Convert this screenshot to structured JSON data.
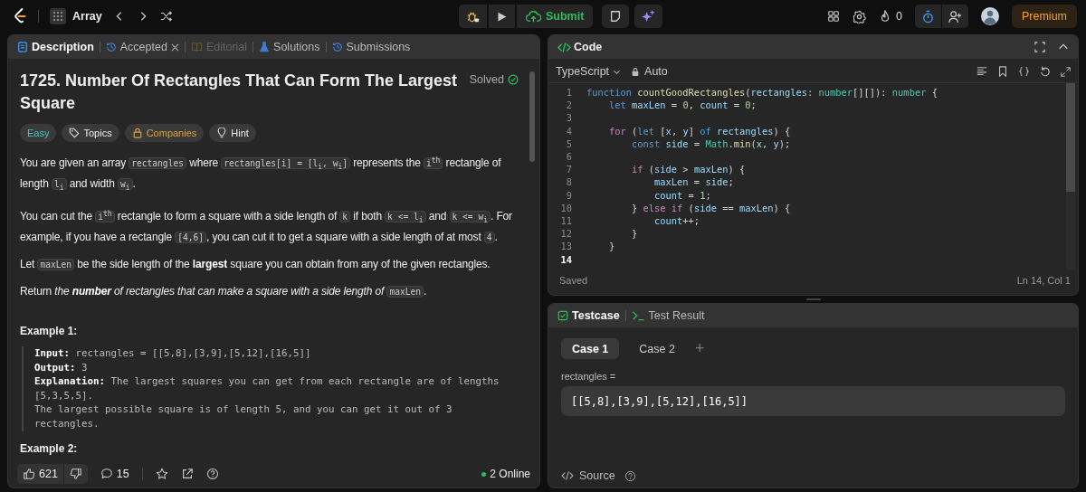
{
  "topbar": {
    "problem_list": "Array",
    "submit": "Submit",
    "streak": "0",
    "premium": "Premium"
  },
  "description_tabs": [
    {
      "label": "Description",
      "selected": true,
      "disabled": false,
      "closable": false,
      "kind": "description"
    },
    {
      "label": "Accepted",
      "selected": false,
      "disabled": false,
      "closable": true,
      "kind": "history"
    },
    {
      "label": "Editorial",
      "selected": false,
      "disabled": true,
      "closable": false,
      "kind": "editorial"
    },
    {
      "label": "Solutions",
      "selected": false,
      "disabled": false,
      "closable": false,
      "kind": "solutions"
    },
    {
      "label": "Submissions",
      "selected": false,
      "disabled": false,
      "closable": false,
      "kind": "history"
    }
  ],
  "problem": {
    "title": "1725. Number Of Rectangles That Can Form The Largest Square",
    "status": "Solved",
    "tags": [
      {
        "label": "Easy",
        "kind": "difficulty"
      },
      {
        "label": "Topics",
        "kind": "topics"
      },
      {
        "label": "Companies",
        "kind": "companies"
      },
      {
        "label": "Hint",
        "kind": "hint"
      }
    ],
    "paragraphs": [
      [
        {
          "kind": "text",
          "text": "You are given an array "
        },
        {
          "kind": "code",
          "text": "rectangles"
        },
        {
          "kind": "text",
          "text": " where "
        },
        {
          "kind": "code",
          "text": "rectangles[i] = [l$_{i}$, w$_{i}$]"
        },
        {
          "kind": "text",
          "text": " represents the "
        },
        {
          "kind": "code",
          "text": "i$^{th}$"
        },
        {
          "kind": "text",
          "text": " rectangle of length "
        },
        {
          "kind": "code",
          "text": "l$_{i}$"
        },
        {
          "kind": "text",
          "text": " and width "
        },
        {
          "kind": "code",
          "text": "w$_{i}$"
        },
        {
          "kind": "text",
          "text": "."
        }
      ],
      [
        {
          "kind": "text",
          "text": "You can cut the "
        },
        {
          "kind": "code",
          "text": "i$^{th}$"
        },
        {
          "kind": "text",
          "text": " rectangle to form a square with a side length of "
        },
        {
          "kind": "code",
          "text": "k"
        },
        {
          "kind": "text",
          "text": " if both "
        },
        {
          "kind": "code",
          "text": "k <= l$_{i}$"
        },
        {
          "kind": "text",
          "text": " and "
        },
        {
          "kind": "code",
          "text": "k <= w$_{i}$"
        },
        {
          "kind": "text",
          "text": ". For example, if you have a rectangle "
        },
        {
          "kind": "code",
          "text": "[4,6]"
        },
        {
          "kind": "text",
          "text": ", you can cut it to get a square with a side length of at most "
        },
        {
          "kind": "code",
          "text": "4"
        },
        {
          "kind": "text",
          "text": "."
        }
      ],
      [
        {
          "kind": "text",
          "text": "Let "
        },
        {
          "kind": "code",
          "text": "maxLen"
        },
        {
          "kind": "text",
          "text": " be the side length of the **largest** square you can obtain from any of the given rectangles."
        }
      ],
      [
        {
          "kind": "text",
          "text": "Return "
        },
        {
          "kind": "em",
          "text": "the **number** of rectangles that can make a square with a side length of "
        },
        {
          "kind": "code",
          "text": "maxLen"
        },
        {
          "kind": "text",
          "text": "."
        }
      ]
    ],
    "examples": [
      {
        "title": "Example 1:",
        "body": "**Input:** rectangles = [[5,8],[3,9],[5,12],[16,5]]\n**Output:** 3\n**Explanation:** The largest squares you can get from each rectangle are of lengths [5,3,5,5].\nThe largest possible square is of length 5, and you can get it out of 3 rectangles."
      },
      {
        "title": "Example 2:"
      }
    ]
  },
  "footer": {
    "likes": "621",
    "comments": "15",
    "online": "2 Online"
  },
  "editor": {
    "title": "Code",
    "language": "TypeScript",
    "mode": "Auto",
    "status": "Saved",
    "cursor": "Ln 14, Col 1",
    "lines": [
      {
        "number": "1",
        "current": false,
        "tokens": [
          {
            "kind": "kw",
            "text": "function "
          },
          {
            "kind": "fn",
            "text": "countGoodRectangles"
          },
          {
            "kind": "p",
            "text": "("
          },
          {
            "kind": "var",
            "text": "rectangles"
          },
          {
            "kind": "p",
            "text": ": "
          },
          {
            "kind": "type",
            "text": "number"
          },
          {
            "kind": "p",
            "text": "[][]): "
          },
          {
            "kind": "type",
            "text": "number"
          },
          {
            "kind": "p",
            "text": " {"
          }
        ]
      },
      {
        "number": "2",
        "current": false,
        "tokens": [
          {
            "kind": "kw",
            "text": "    let "
          },
          {
            "kind": "var",
            "text": "maxLen"
          },
          {
            "kind": "p",
            "text": " = "
          },
          {
            "kind": "num",
            "text": "0"
          },
          {
            "kind": "p",
            "text": ", "
          },
          {
            "kind": "var",
            "text": "count"
          },
          {
            "kind": "p",
            "text": " = "
          },
          {
            "kind": "num",
            "text": "0"
          },
          {
            "kind": "p",
            "text": ";"
          }
        ]
      },
      {
        "number": "3",
        "current": false
      },
      {
        "number": "4",
        "current": false,
        "tokens": [
          {
            "kind": "ctrl",
            "text": "    for"
          },
          {
            "kind": "p",
            "text": " ("
          },
          {
            "kind": "kw",
            "text": "let"
          },
          {
            "kind": "p",
            "text": " ["
          },
          {
            "kind": "var",
            "text": "x"
          },
          {
            "kind": "p",
            "text": ", "
          },
          {
            "kind": "var",
            "text": "y"
          },
          {
            "kind": "p",
            "text": "] "
          },
          {
            "kind": "kw",
            "text": "of "
          },
          {
            "kind": "var",
            "text": "rectangles"
          },
          {
            "kind": "p",
            "text": ") {"
          }
        ]
      },
      {
        "number": "5",
        "current": false,
        "tokens": [
          {
            "kind": "kw",
            "text": "        const "
          },
          {
            "kind": "var",
            "text": "side"
          },
          {
            "kind": "p",
            "text": " = "
          },
          {
            "kind": "type",
            "text": "Math"
          },
          {
            "kind": "p",
            "text": "."
          },
          {
            "kind": "fn",
            "text": "min"
          },
          {
            "kind": "p",
            "text": "("
          },
          {
            "kind": "var",
            "text": "x"
          },
          {
            "kind": "p",
            "text": ", "
          },
          {
            "kind": "var",
            "text": "y"
          },
          {
            "kind": "p",
            "text": ");"
          }
        ]
      },
      {
        "number": "6",
        "current": false
      },
      {
        "number": "7",
        "current": false,
        "tokens": [
          {
            "kind": "ctrl",
            "text": "        if"
          },
          {
            "kind": "p",
            "text": " ("
          },
          {
            "kind": "var",
            "text": "side"
          },
          {
            "kind": "p",
            "text": " > "
          },
          {
            "kind": "var",
            "text": "maxLen"
          },
          {
            "kind": "p",
            "text": ") {"
          }
        ]
      },
      {
        "number": "8",
        "current": false,
        "tokens": [
          {
            "kind": "var",
            "text": "            maxLen"
          },
          {
            "kind": "p",
            "text": " = "
          },
          {
            "kind": "var",
            "text": "side"
          },
          {
            "kind": "p",
            "text": ";"
          }
        ]
      },
      {
        "number": "9",
        "current": false,
        "tokens": [
          {
            "kind": "var",
            "text": "            count"
          },
          {
            "kind": "p",
            "text": " = "
          },
          {
            "kind": "num",
            "text": "1"
          },
          {
            "kind": "p",
            "text": ";"
          }
        ]
      },
      {
        "number": "10",
        "current": false,
        "tokens": [
          {
            "kind": "p",
            "text": "        } "
          },
          {
            "kind": "ctrl",
            "text": "else if"
          },
          {
            "kind": "p",
            "text": " ("
          },
          {
            "kind": "var",
            "text": "side"
          },
          {
            "kind": "p",
            "text": " == "
          },
          {
            "kind": "var",
            "text": "maxLen"
          },
          {
            "kind": "p",
            "text": ") {"
          }
        ]
      },
      {
        "number": "11",
        "current": false,
        "tokens": [
          {
            "kind": "var",
            "text": "            count"
          },
          {
            "kind": "p",
            "text": "++;"
          }
        ]
      },
      {
        "number": "12",
        "current": false,
        "tokens": [
          {
            "kind": "p",
            "text": "        }"
          }
        ]
      },
      {
        "number": "13",
        "current": false,
        "tokens": [
          {
            "kind": "p",
            "text": "    }"
          }
        ]
      },
      {
        "number": "14",
        "current": true
      }
    ]
  },
  "testcase": {
    "tabs": [
      {
        "label": "Testcase",
        "selected": true,
        "kind": "testcase"
      },
      {
        "label": "Test Result",
        "selected": false,
        "kind": "result"
      }
    ],
    "cases": [
      {
        "label": "Case 1",
        "selected": true
      },
      {
        "label": "Case 2",
        "selected": false
      }
    ],
    "add": "+",
    "param_label": "rectangles =",
    "value": "[[5,8],[3,9],[5,12],[16,5]]",
    "source": "Source"
  }
}
